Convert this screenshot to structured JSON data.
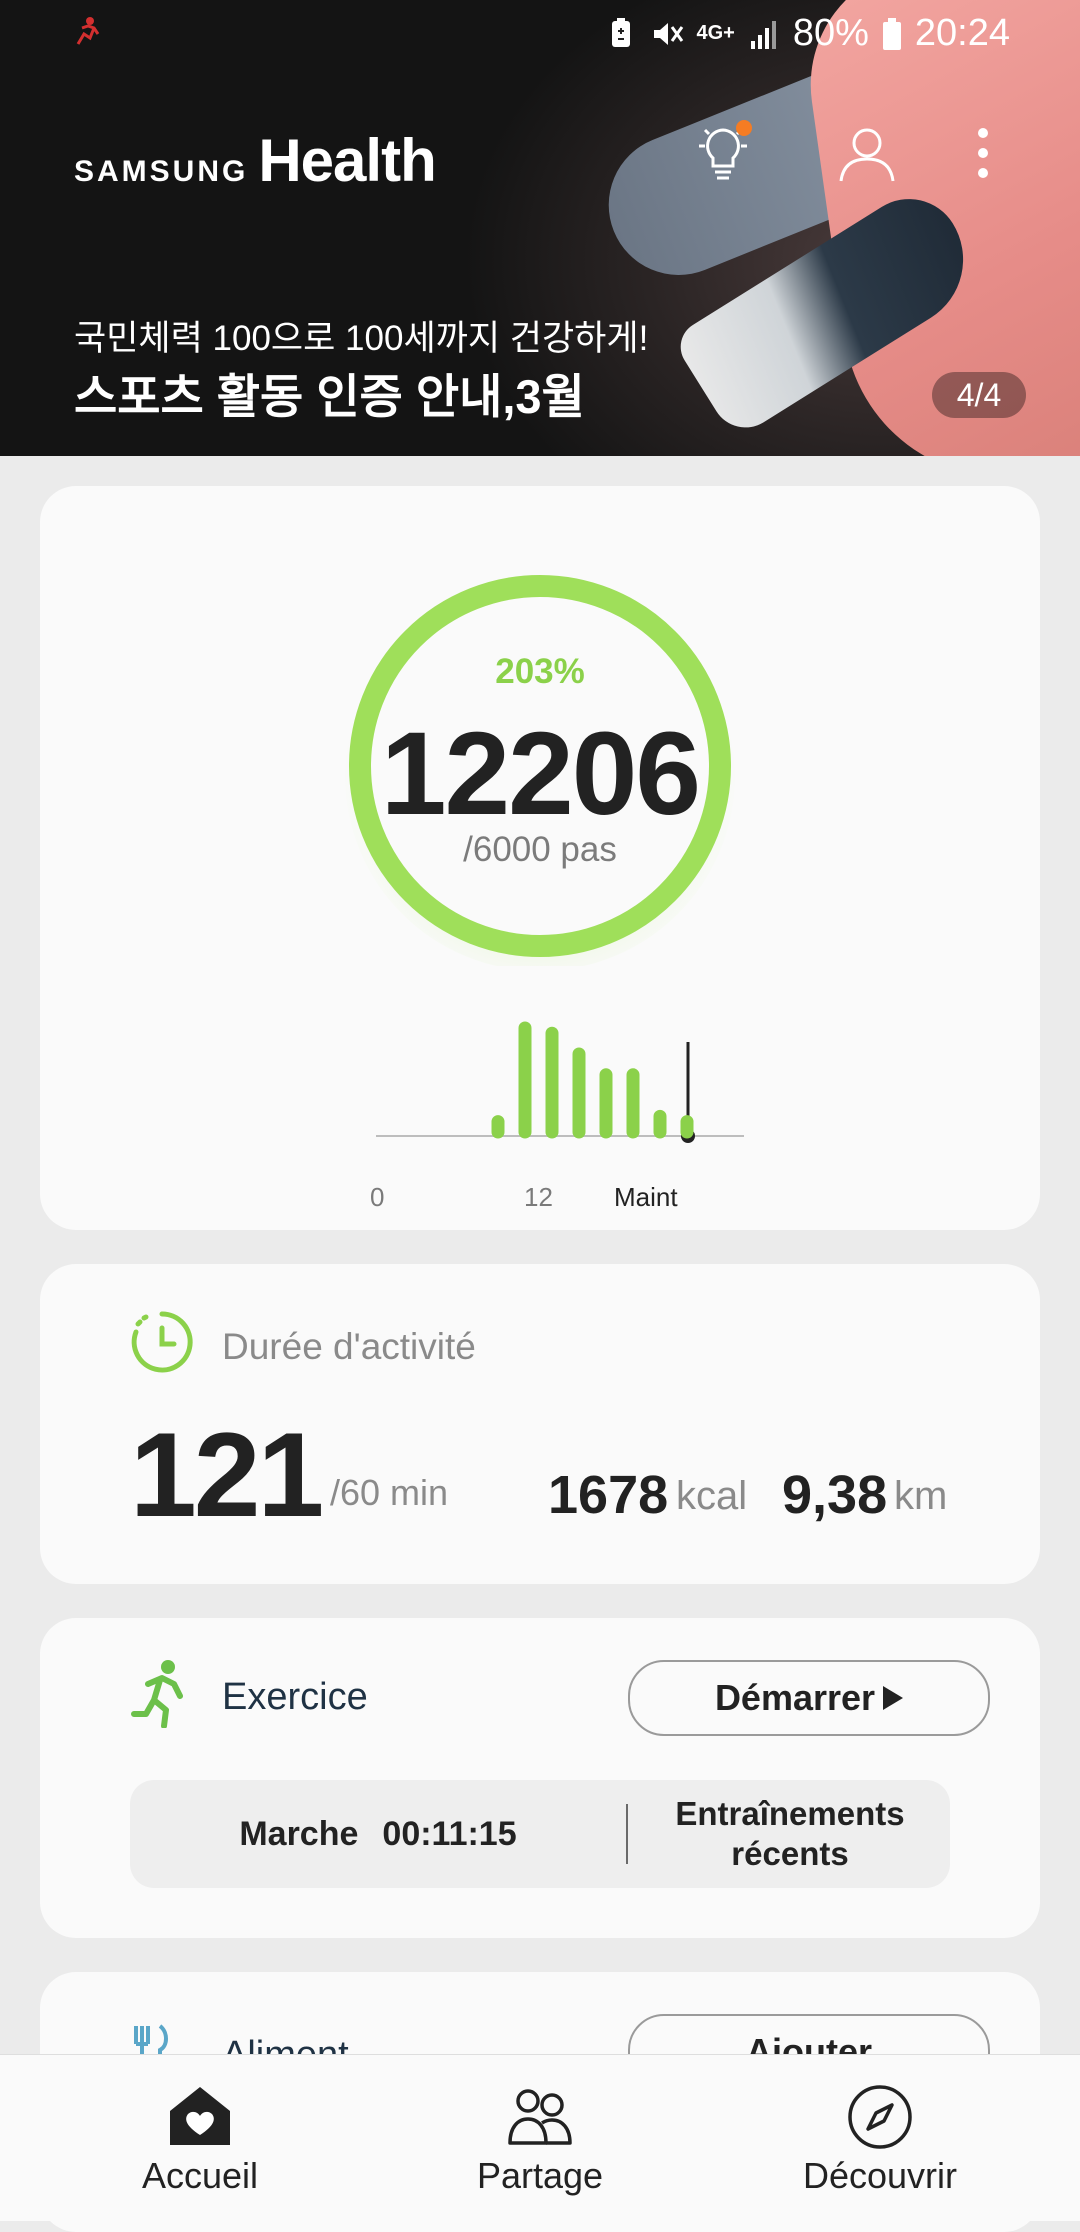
{
  "status_bar": {
    "battery": "80%",
    "time": "20:24",
    "network": "4G+"
  },
  "header": {
    "brand_small": "SAMSUNG",
    "brand_large": "Health"
  },
  "banner": {
    "subtitle": "국민체력 100으로 100세까지 건강하게!",
    "title": "스포츠 활동 인증 안내,3월",
    "page_indicator": "4/4"
  },
  "steps": {
    "percent": "203%",
    "count": "12206",
    "goal": "/6000 pas",
    "progress": 2.03,
    "chart_data": {
      "type": "bar",
      "x_labels": [
        "0",
        "12",
        "Maint"
      ],
      "values": [
        0.1,
        1.0,
        0.95,
        0.75,
        0.55,
        0.55,
        0.15,
        0.1
      ]
    }
  },
  "activity": {
    "title": "Durée d'activité",
    "value": "121",
    "goal": "/60 min",
    "kcal_value": "1678",
    "kcal_unit": "kcal",
    "km_value": "9,38",
    "km_unit": "km"
  },
  "exercise": {
    "title": "Exercice",
    "start_label": "Démarrer",
    "last_type": "Marche",
    "last_time": "00:11:15",
    "recent_line1": "Entraînements",
    "recent_line2": "récents"
  },
  "food": {
    "title": "Aliment",
    "add_label": "Ajouter"
  },
  "bottom_nav": {
    "home": "Accueil",
    "share": "Partage",
    "discover": "Découvrir"
  },
  "colors": {
    "accent_green": "#8bd14a",
    "notification_dot": "#f57c23"
  }
}
